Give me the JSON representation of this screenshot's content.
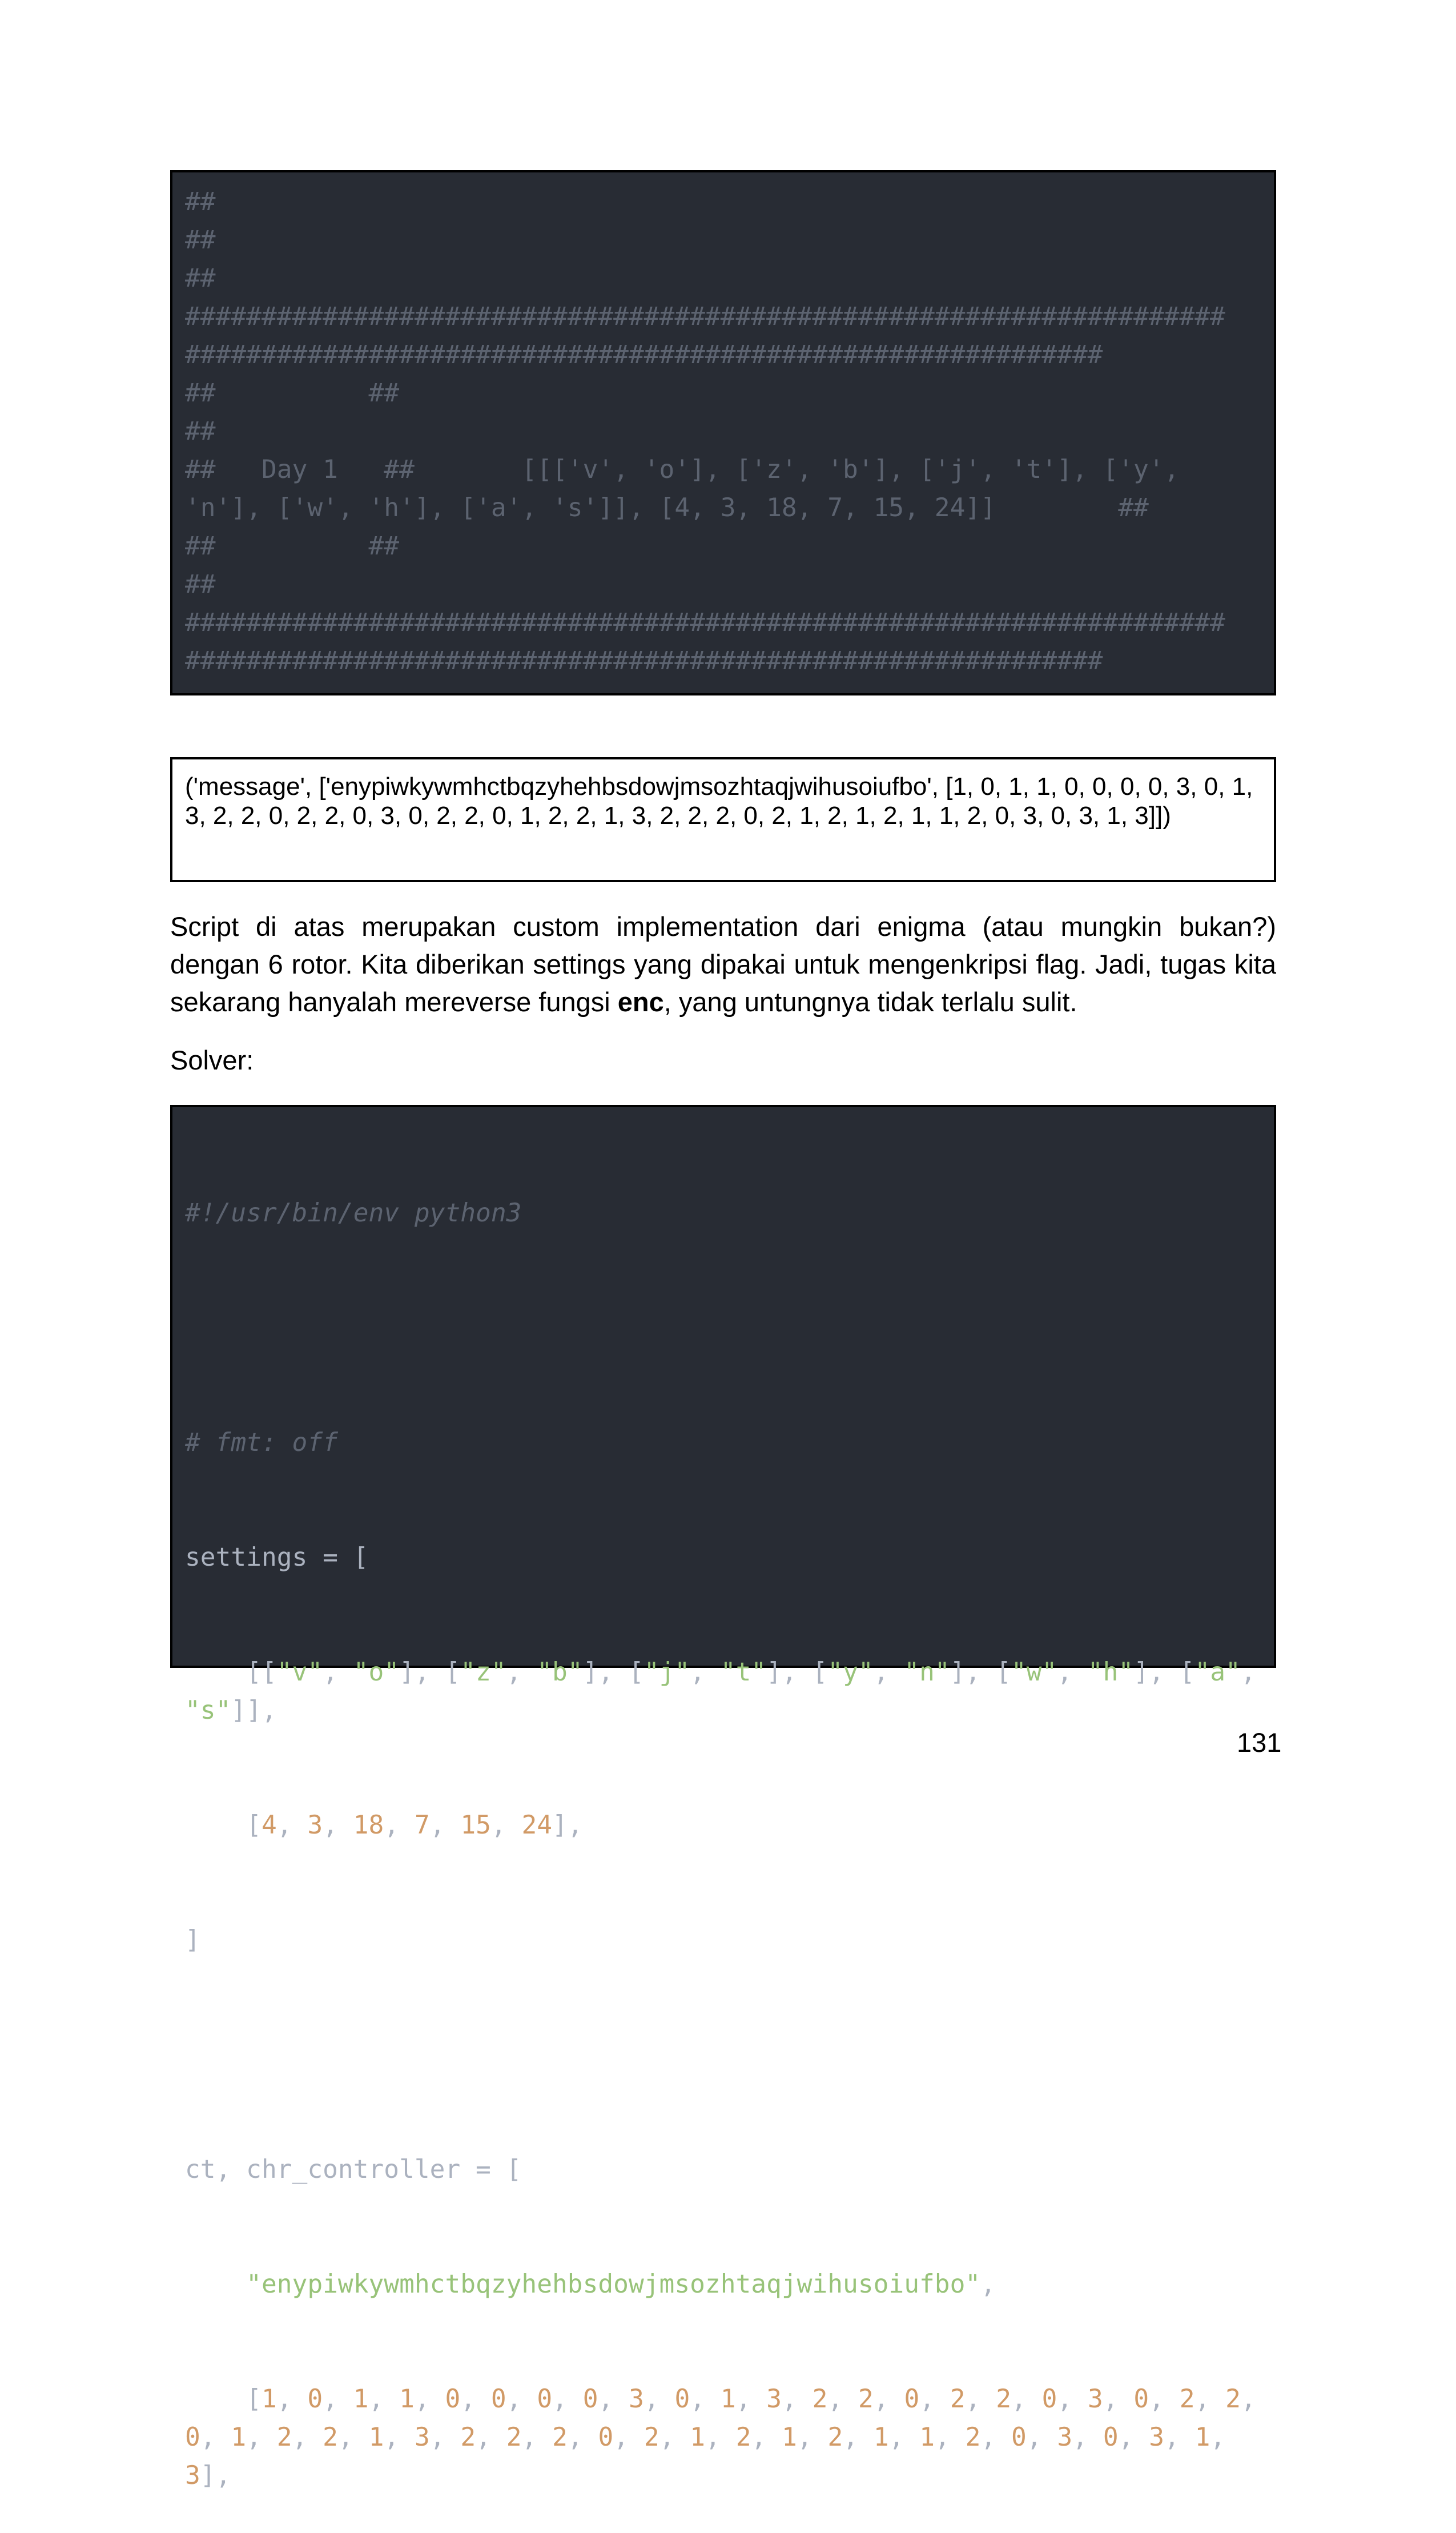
{
  "code_block_1": {
    "lines": [
      "##",
      "##",
      "##",
      "####################################################################",
      "############################################################",
      "##          ##",
      "##",
      "##   Day 1   ##       [[['v', 'o'], ['z', 'b'], ['j', 't'], ['y',",
      "'n'], ['w', 'h'], ['a', 's']], [4, 3, 18, 7, 15, 24]]        ##",
      "##          ##",
      "##",
      "####################################################################",
      "############################################################"
    ]
  },
  "output_box": {
    "text": "('message', ['enypiwkywmhctbqzyhehbsdowjmsozhtaqjwihusoiufbo', [1, 0, 1, 1, 0, 0, 0, 0, 3, 0, 1, 3, 2, 2, 0, 2, 2, 0, 3, 0, 2, 2, 0, 1, 2, 2, 1, 3, 2, 2, 2, 0, 2, 1, 2, 1, 2, 1, 1, 2, 0, 3, 0, 3, 1, 3]])"
  },
  "paragraph": {
    "before": "Script di atas merupakan custom implementation dari enigma (atau mungkin bukan?) dengan 6 rotor. Kita diberikan settings yang dipakai untuk mengenkripsi flag. Jadi, tugas kita sekarang hanyalah mereverse fungsi ",
    "bold": "enc",
    "after": ", yang untungnya tidak terlalu sulit."
  },
  "solver_label": "Solver:",
  "code_block_2": {
    "shebang": "#!/usr/bin/env python3",
    "fmt_comment": "# fmt: off",
    "settings_open": "settings = [",
    "settings_close": "]",
    "pairs": [
      [
        "v",
        "o"
      ],
      [
        "z",
        "b"
      ],
      [
        "j",
        "t"
      ],
      [
        "y",
        "n"
      ],
      [
        "w",
        "h"
      ],
      [
        "a",
        "s"
      ]
    ],
    "numbers": [
      "4",
      "3",
      "18",
      "7",
      "15",
      "24"
    ],
    "ct_open": "ct, chr_controller = [",
    "ct_string": "\"enypiwkywmhctbqzyhehbsdowjmsozhtaqjwihusoiufbo\"",
    "controller": [
      "1",
      "0",
      "1",
      "1",
      "0",
      "0",
      "0",
      "0",
      "3",
      "0",
      "1",
      "3",
      "2",
      "2",
      "0",
      "2",
      "2",
      "0",
      "3",
      "0",
      "2",
      "2",
      "0",
      "1",
      "2",
      "2",
      "1",
      "3",
      "2",
      "2",
      "2",
      "0",
      "2",
      "1",
      "2",
      "1",
      "2",
      "1",
      "1",
      "2",
      "0",
      "3",
      "0",
      "3",
      "1",
      "3"
    ]
  },
  "page_number": "131"
}
